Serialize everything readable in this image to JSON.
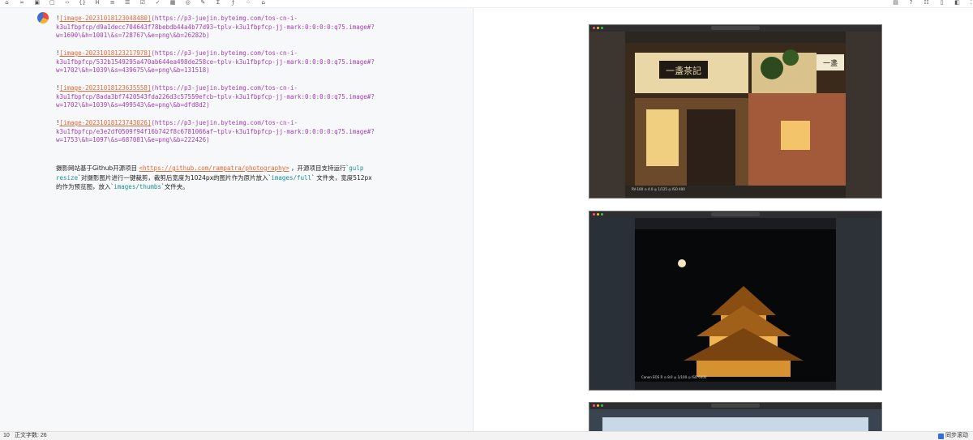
{
  "toolbar": {
    "icons": [
      "tag-icon",
      "link-icon",
      "image-icon",
      "frame-icon",
      "code-icon",
      "braces-icon",
      "heading-icon",
      "list-icon",
      "ordered-list-icon",
      "checklist-icon",
      "todo-icon",
      "table-icon",
      "circle-icon",
      "edit-icon",
      "sum-icon",
      "formula-icon",
      "grid-icon",
      "home-icon"
    ],
    "right_icons": [
      "save-icon",
      "help-icon",
      "toc-icon",
      "split-icon",
      "preview-icon",
      "fullscreen-icon"
    ]
  },
  "editor": {
    "images": [
      {
        "bang": "!",
        "alt": "[image-20231018123048480]",
        "line1": "(https://p3-juejin.byteimg.com/tos-cn-i-",
        "line2": "k3u1fbpfcp/d9a1decc704643f78bebdb44a4b77d93~tplv-k3u1fbpfcp-jj-mark:0:0:0:0:q75.image#?",
        "line3": "w=1690\\&h=1001\\&s=728767\\&e=png\\&b=26282b)"
      },
      {
        "bang": "!",
        "alt": "[image-20231018123217978]",
        "line1": "(https://p3-juejin.byteimg.com/tos-cn-i-",
        "line2": "k3u1fbpfcp/532b1549295a470ab644ea498de258ce~tplv-k3u1fbpfcp-jj-mark:0:0:0:0:q75.image#?",
        "line3": "w=1702\\&h=1039\\&s=439675\\&e=png\\&b=131518)"
      },
      {
        "bang": "!",
        "alt": "[image-20231018123635558]",
        "line1": "(https://p3-juejin.byteimg.com/tos-cn-i-",
        "line2": "k3u1fbpfcp/8ada3bf7420543fda226d3c57559efcb~tplv-k3u1fbpfcp-jj-mark:0:0:0:0:q75.image#?",
        "line3": "w=1702\\&h=1039\\&s=499543\\&e=png\\&b=dfd8d2)"
      },
      {
        "bang": "!",
        "alt": "[image-20231018123743026]",
        "line1": "(https://p3-juejin.byteimg.com/tos-cn-i-",
        "line2": "k3u1fbpfcp/e3e2df0509f94f16b742f8c6781066af~tplv-k3u1fbpfcp-jj-mark:0:0:0:0:q75.image#?",
        "line3": "w=1753\\&h=1097\\&s=687081\\&e=png\\&b=222426)"
      }
    ],
    "paragraph": {
      "t1": "摄影网站基于Github开源项目 ",
      "link": "<https://github.com/rampatra/photography>",
      "t2": " ，开源项目支持运行`",
      "code1": "gulp resize",
      "t3": "`对摄影图片进行一键裁剪，裁剪后宽度为1024px的图片作为原片放入`",
      "code2": "images/full",
      "t4": "` 文件夹，宽度512px的作为预览图，放入`",
      "code3": "images/thumbs",
      "t5": "`文件夹。"
    }
  },
  "preview": {
    "shots": [
      {
        "caption": "RV-100 ⊙ 4.0 ◎ 1/125 ◎ ISO 400",
        "accent": "#c89a4a"
      },
      {
        "caption": "Canon EOS R ⊙ 8.0 ◎ 1/100 ◎ ISO 6400",
        "accent": "#d9a14a"
      },
      {
        "caption": "",
        "accent": "#8fb0cc"
      }
    ]
  },
  "status": {
    "line": "10",
    "words": "正文字数: 26",
    "sync": "同步滚动"
  }
}
